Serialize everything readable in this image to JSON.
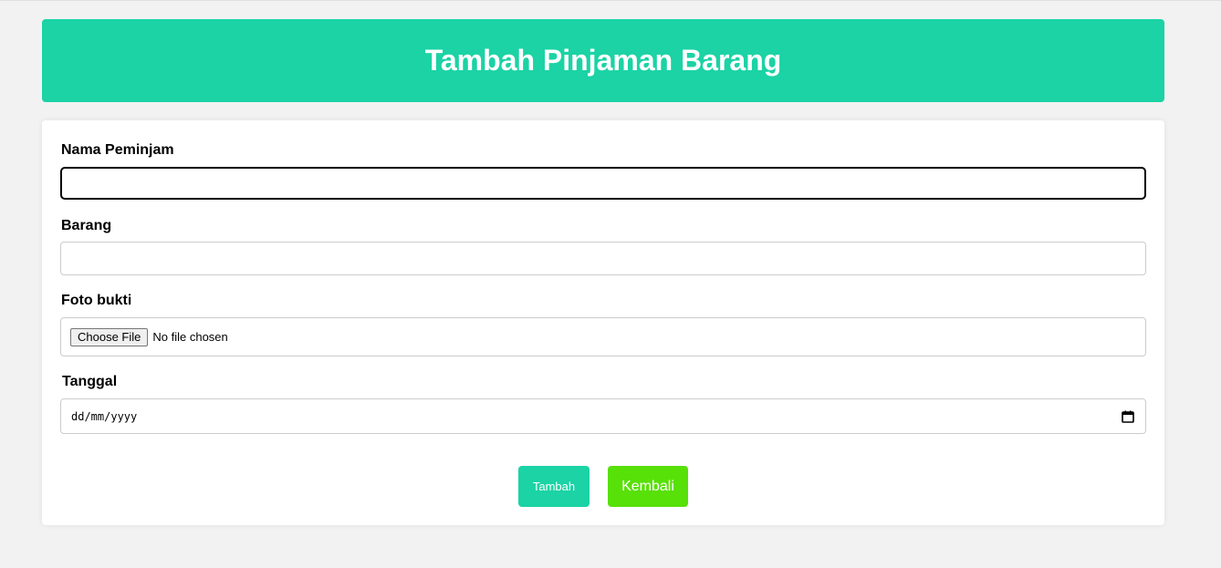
{
  "header": {
    "title": "Tambah Pinjaman Barang"
  },
  "form": {
    "nama_peminjam": {
      "label": "Nama Peminjam",
      "value": ""
    },
    "barang": {
      "label": "Barang",
      "value": ""
    },
    "foto_bukti": {
      "label": "Foto bukti",
      "button_label": "Choose File",
      "status": "No file chosen"
    },
    "tanggal": {
      "label": "Tanggal",
      "placeholder": "dd/mm/yyyy",
      "icon": "calendar-icon"
    }
  },
  "actions": {
    "tambah_label": "Tambah",
    "kembali_label": "Kembali"
  },
  "colors": {
    "page_bg": "#f2f2f2",
    "header_bg": "#1bd3a5",
    "tambah_bg": "#1bd3a5",
    "kembali_bg": "#58e009"
  }
}
